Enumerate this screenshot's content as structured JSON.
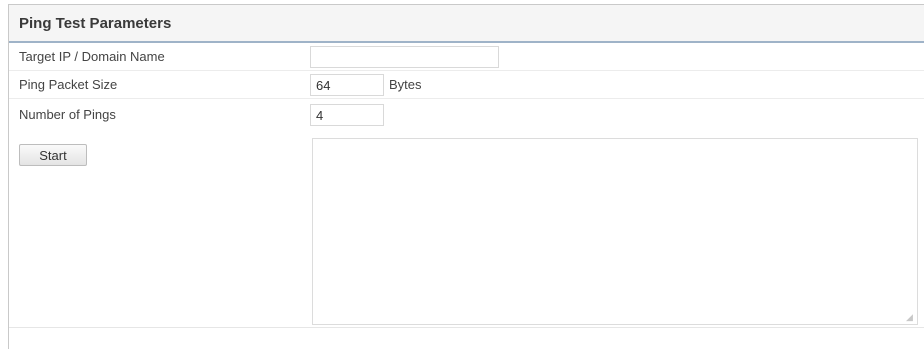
{
  "panel": {
    "title": "Ping Test Parameters"
  },
  "form": {
    "target": {
      "label": "Target IP / Domain Name",
      "value": ""
    },
    "packet_size": {
      "label": "Ping Packet Size",
      "value": "64",
      "unit": "Bytes"
    },
    "num_pings": {
      "label": "Number of Pings",
      "value": "4"
    },
    "start_label": "Start",
    "output_value": ""
  }
}
